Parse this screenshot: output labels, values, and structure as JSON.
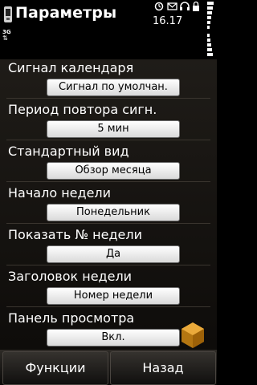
{
  "status": {
    "title": "Параметры",
    "time": "16.17",
    "network": "3G"
  },
  "settings": [
    {
      "label": "Сигнал календаря",
      "value": "Сигнал по умолчан."
    },
    {
      "label": "Период повтора сигн.",
      "value": "5 мин"
    },
    {
      "label": "Стандартный вид",
      "value": "Обзор месяца"
    },
    {
      "label": "Начало недели",
      "value": "Понедельник"
    },
    {
      "label": "Показать № недели",
      "value": "Да"
    },
    {
      "label": "Заголовок недели",
      "value": "Номер недели"
    },
    {
      "label": "Панель просмотра",
      "value": "Вкл."
    }
  ],
  "softkeys": {
    "left": "Функции",
    "right": "Назад"
  },
  "colors": {
    "background": "#000000",
    "field": "#ffffff",
    "watermark": "#d18a13"
  }
}
